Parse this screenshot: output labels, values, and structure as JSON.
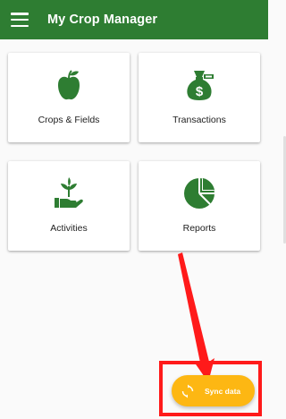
{
  "app": {
    "title": "My Crop Manager"
  },
  "dashboard": {
    "cards": [
      {
        "label": "Crops & Fields",
        "icon": "apple-icon"
      },
      {
        "label": "Transactions",
        "icon": "money-bag-icon"
      },
      {
        "label": "Activities",
        "icon": "plant-in-hand-icon"
      },
      {
        "label": "Reports",
        "icon": "pie-chart-icon"
      }
    ]
  },
  "fab": {
    "label": "Sync data",
    "icon": "sync-icon"
  },
  "colors": {
    "primary": "#2e7d32",
    "accent": "#fdb713",
    "annotation": "#ff1a1a"
  }
}
